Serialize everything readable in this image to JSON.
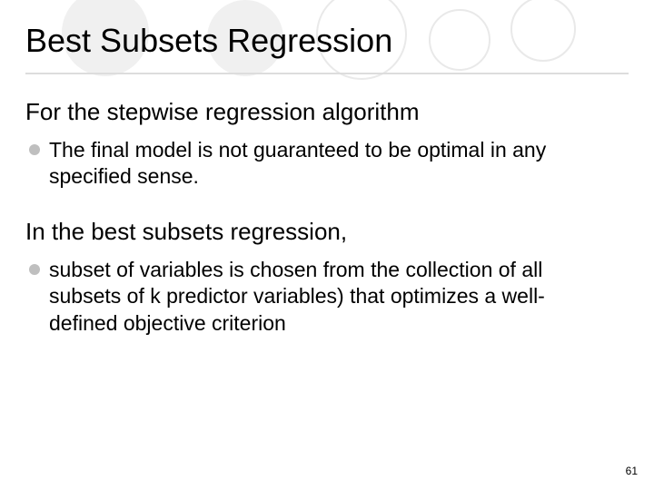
{
  "title": "Best Subsets Regression",
  "sections": [
    {
      "heading": "For the stepwise regression  algorithm",
      "bullet": "The final model is not guaranteed to be optimal in any specified sense."
    },
    {
      "heading": "In the best subsets regression,",
      "bullet": "subset of variables is chosen from the collection of all subsets of k predictor variables) that optimizes a well-defined objective criterion"
    }
  ],
  "page_number": "61"
}
